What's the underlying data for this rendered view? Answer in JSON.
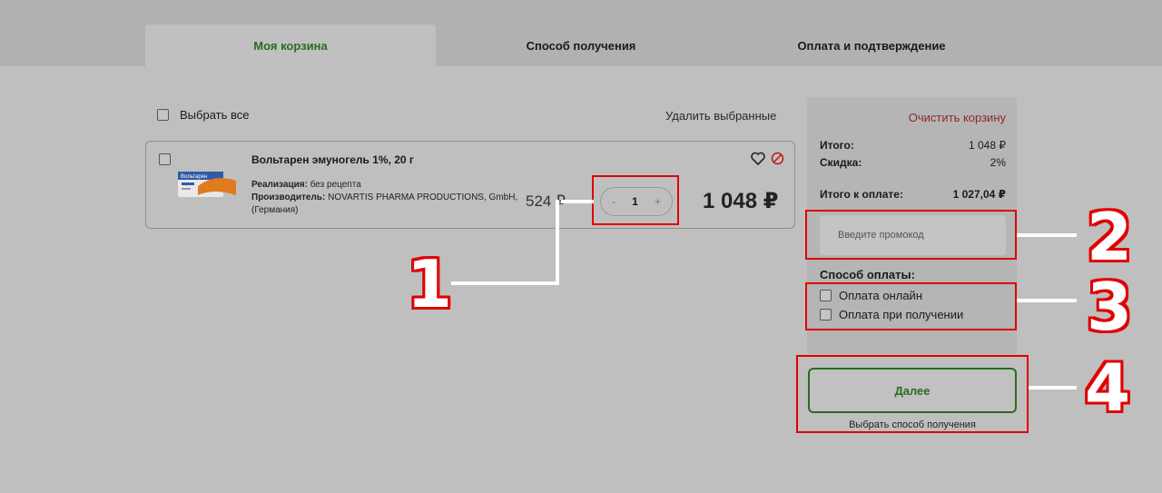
{
  "tabs": [
    {
      "label": "Моя корзина",
      "active": true
    },
    {
      "label": "Способ получения",
      "active": false
    },
    {
      "label": "Оплата и подтверждение",
      "active": false
    }
  ],
  "cart": {
    "select_all_label": "Выбрать все",
    "delete_selected_label": "Удалить выбранные"
  },
  "product": {
    "name": "Вольтарен эмуногель 1%, 20 г",
    "sale_label": "Реализация:",
    "sale_value": "без рецепта",
    "manufacturer_label": "Производитель:",
    "manufacturer_value": "NOVARTIS PHARMA PRODUCTIONS, GmbH, (Германия)",
    "unit_price": "524 ₽",
    "qty_minus": "-",
    "qty": "1",
    "qty_plus": "+",
    "total_price": "1 048 ₽",
    "image_brand_text": "Вольтарен"
  },
  "summary": {
    "clear_cart": "Очистить корзину",
    "rows": [
      {
        "label": "Итого:",
        "value": "1 048 ₽"
      },
      {
        "label": "Скидка:",
        "value": "2%"
      },
      {
        "label": "Итого к оплате:",
        "value": "1 027,04 ₽"
      }
    ],
    "promo_placeholder": "Введите промокод",
    "payment_title": "Способ оплаты:",
    "payment_options": [
      "Оплата онлайн",
      "Оплата при получении"
    ]
  },
  "next": {
    "button": "Далее",
    "hint": "Выбрать способ получения"
  },
  "callouts": [
    "1",
    "2",
    "3",
    "4"
  ],
  "colors": {
    "accent_green": "#2b6b22",
    "highlight_red": "#e00000",
    "clear_cart_red": "#8b2a2a"
  }
}
